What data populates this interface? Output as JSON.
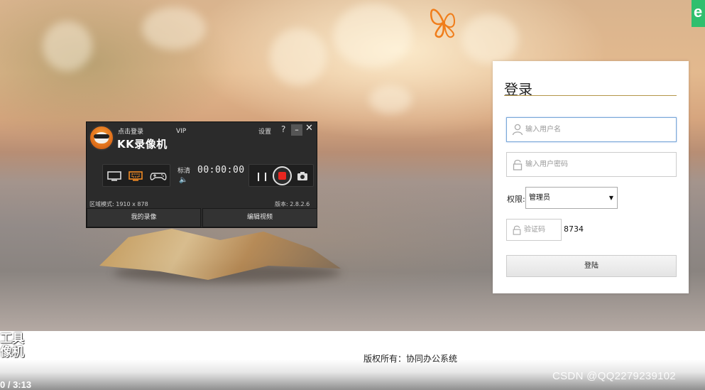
{
  "kk_recorder": {
    "login_label": "点击登录",
    "vip_label": "VIP",
    "title": "KK录像机",
    "settings_label": "设置",
    "help_label": "?",
    "minimize_label": "–",
    "close_label": "✕",
    "quality_label": "标清",
    "timer": "00:00:00",
    "region_mode": "区域模式: 1910 x 878",
    "version": "版本: 2.8.2.6",
    "my_videos_label": "我的录像",
    "edit_video_label": "编辑视频",
    "mode_icons": [
      "monitor-icon",
      "region-icon",
      "gamepad-icon"
    ],
    "accent_color": "#e8261f"
  },
  "login": {
    "title": "登录",
    "username_placeholder": "输入用户名",
    "password_placeholder": "输入用户密码",
    "role_label": "权限:",
    "role_selected": "管理员",
    "captcha_placeholder": "验证码",
    "captcha_code": "8734",
    "submit_label": "登陆"
  },
  "footer": {
    "copyright": "版权所有：协同办公系统",
    "watermark_line1": "工具",
    "watermark_line2": "像机",
    "video_time": "0 / 3:13",
    "csdn_watermark": "CSDN @QQ2279239102"
  },
  "top_right_badge": "e"
}
